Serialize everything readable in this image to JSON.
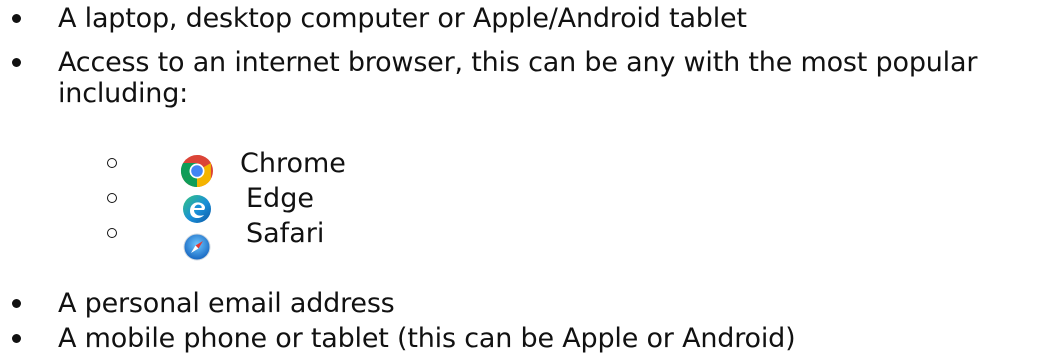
{
  "requirements": [
    {
      "text": "A laptop, desktop computer or Apple/Android tablet"
    },
    {
      "text": "Access to an internet browser, this can be any with the most popular",
      "continuation": "including:"
    }
  ],
  "browsers": [
    {
      "label": "Chrome",
      "icon": "chrome-icon"
    },
    {
      "label": "Edge",
      "icon": "edge-icon"
    },
    {
      "label": "Safari",
      "icon": "safari-icon"
    }
  ],
  "requirements_after": [
    {
      "text": "A personal email address"
    },
    {
      "text": "A mobile phone or tablet (this can be Apple or Android)"
    }
  ],
  "colors": {
    "text": "#111111",
    "chrome_red": "#DB4437",
    "chrome_yellow": "#F4B400",
    "chrome_green": "#0F9D58",
    "chrome_blue": "#4285F4",
    "edge_blue": "#0C59A4",
    "edge_green": "#33C481",
    "safari_blue": "#1E88E5"
  }
}
